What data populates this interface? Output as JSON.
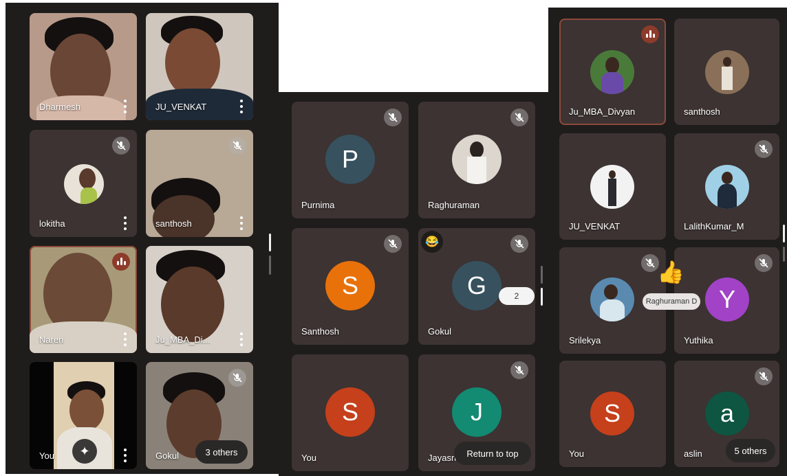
{
  "panel_left": {
    "tiles": [
      {
        "name": "Dharmesh",
        "has_menu": true
      },
      {
        "name": "JU_VENKAT",
        "has_menu": true
      },
      {
        "name": "lokitha",
        "has_menu": true,
        "muted": true
      },
      {
        "name": "santhosh",
        "has_menu": true,
        "muted": true
      },
      {
        "name": "Naren",
        "has_menu": true,
        "speaking": true
      },
      {
        "name": "Ju_MBA_Di...",
        "has_menu": true
      },
      {
        "name": "You",
        "has_menu": true
      },
      {
        "name": "Gokul",
        "muted": true
      }
    ],
    "others_label": "3 others",
    "effects_icon": "sparkle-icon"
  },
  "panel_middle": {
    "tiles": [
      {
        "name": "Purnima",
        "initial": "P",
        "color": "#37515f",
        "muted": true
      },
      {
        "name": "Raghuraman",
        "muted": true
      },
      {
        "name": "Santhosh",
        "initial": "S",
        "color": "#e8710a",
        "muted": true
      },
      {
        "name": "Gokul",
        "initial": "G",
        "color": "#37515f",
        "muted": true
      },
      {
        "name": "You",
        "initial": "S",
        "color": "#c5401b"
      },
      {
        "name": "Jayasri",
        "initial": "J",
        "color": "#138a72",
        "muted": true
      }
    ],
    "reaction_emoji": "😂",
    "hand_count": "2",
    "return_label": "Return to top"
  },
  "panel_right": {
    "tiles": [
      {
        "name": "Ju_MBA_Divyan",
        "speaking": true
      },
      {
        "name": "santhosh"
      },
      {
        "name": "JU_VENKAT"
      },
      {
        "name": "LalithKumar_M",
        "muted": true
      },
      {
        "name": "Srilekya",
        "muted": true
      },
      {
        "name": "Yuthika",
        "initial": "Y",
        "color": "#a142c7",
        "muted": true
      },
      {
        "name": "You",
        "initial": "S",
        "color": "#c5401b"
      },
      {
        "name": "aslin",
        "initial": "a",
        "color": "#0e5542",
        "muted": true
      }
    ],
    "reaction_emoji": "👍",
    "reaction_name": "Raghuraman D",
    "others_label": "5 others"
  },
  "colors": {
    "tile_bg": "#3c3332",
    "panel_bg": "#1f1c1c",
    "speaking": "#8d3b2b"
  }
}
